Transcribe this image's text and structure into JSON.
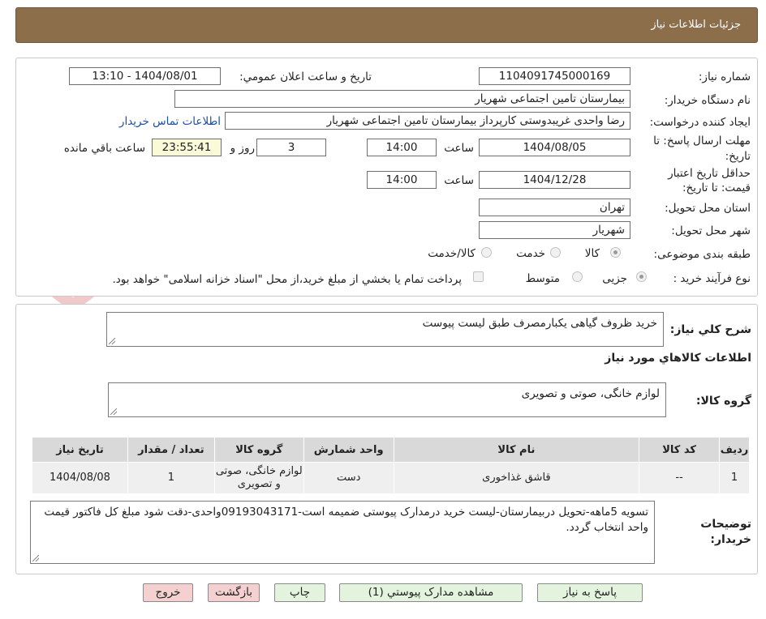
{
  "header": {
    "title": "جزئیات اطلاعات نیاز"
  },
  "watermark": {
    "text": "AriaTender.neT"
  },
  "form": {
    "need_number_label": "شماره نیاز:",
    "need_number": "1104091745000169",
    "announce_label": "تاریخ و ساعت اعلان عمومي:",
    "announce_value": "1404/08/01 - 13:10",
    "buyer_org_label": "نام دستگاه خريدار:",
    "buyer_org": "بیمارستان تامین اجتماعی شهریار",
    "requester_label": "ايجاد کننده درخواست:",
    "requester": "رضا واحدی غریبدوستی کارپرداز بیمارستان تامین اجتماعی شهریار",
    "contact_link": "اطلاعات تماس خريدار",
    "deadline_label_1": "مهلت ارسال پاسخ: تا",
    "deadline_label_2": "تاریخ:",
    "deadline_date": "1404/08/05",
    "time_label": "ساعت",
    "deadline_time": "14:00",
    "days_count": "3",
    "days_label": "روز و",
    "remaining_time": "23:55:41",
    "remaining_label": "ساعت باقي مانده",
    "validity_label_1": "حداقل تاريخ اعتبار",
    "validity_label_2": "قيمت: تا تاريخ:",
    "validity_date": "1404/12/28",
    "validity_time": "14:00",
    "province_label": "استان محل تحويل:",
    "province": "تهران",
    "city_label": "شهر محل تحويل:",
    "city": "شهریار",
    "category_label": "طبقه بندی موضوعی:",
    "category_options": [
      "کالا",
      "خدمت",
      "کالا/خدمت"
    ],
    "process_label": "نوع فرآيند خريد :",
    "process_options": [
      "جزیی",
      "متوسط"
    ],
    "payment_note": "پرداخت تمام يا بخشي از مبلغ خريد،از محل \"اسناد خزانه اسلامی\" خواهد بود."
  },
  "details": {
    "summary_label": "شرح کلي نياز:",
    "summary": "خرید ظروف گیاهی یکبارمصرف طبق لیست پیوست",
    "goods_info_title": "اطلاعات کالاهاي مورد نياز",
    "goods_group_label": "گروه کالا:",
    "goods_group": "لوازم خانگی، صوتی و تصویری",
    "table": {
      "headers": [
        "رديف",
        "کد کالا",
        "نام کالا",
        "واحد شمارش",
        "گروه کالا",
        "تعداد / مقدار",
        "تاريخ نياز"
      ],
      "rows": [
        [
          "1",
          "--",
          "قاشق غذاخوری",
          "دست",
          "لوازم خانگی، صوتی و تصویری",
          "1",
          "1404/08/08"
        ]
      ]
    },
    "buyer_notes_label_1": "توضيحات",
    "buyer_notes_label_2": "خريدار:",
    "buyer_notes": "تسویه 5ماهه-تحویل دربیمارستان-لیست خرید درمدارک پیوستی ضمیمه است-09193043171واحدی-دقت شود مبلغ کل فاکتور قیمت واحد انتخاب گردد."
  },
  "buttons": {
    "reply": "پاسخ به نياز",
    "attachments": "مشاهده مدارک پيوستي (1)",
    "print": "چاپ",
    "back": "بازگشت",
    "exit": "خروج"
  }
}
